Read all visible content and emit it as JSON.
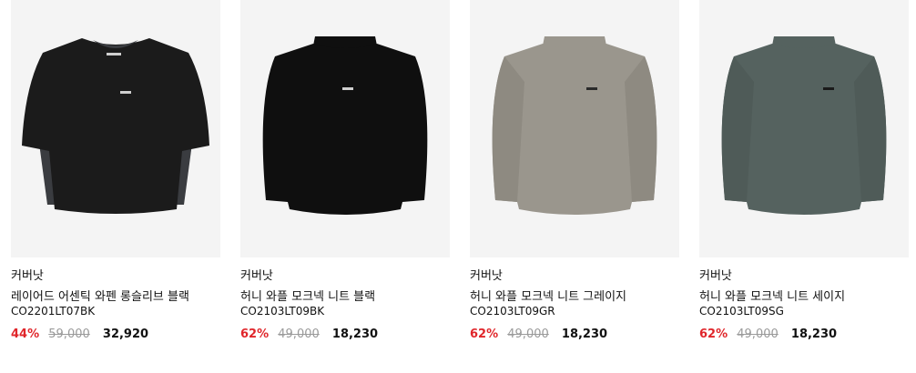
{
  "products": [
    {
      "brand": "커버낫",
      "name": "레이어드 어센틱 와펜 롱슬리브 블랙",
      "code": "CO2201LT07BK",
      "discount": "44%",
      "original_price": "59,000",
      "sale_price": "32,920",
      "body_color": "#1b1b1b",
      "sleeve_color": "#3a3c40"
    },
    {
      "brand": "커버낫",
      "name": "허니 와플 모크넥 니트 블랙",
      "code": "CO2103LT09BK",
      "discount": "62%",
      "original_price": "49,000",
      "sale_price": "18,230",
      "body_color": "#0f0f0f",
      "sleeve_color": "#0f0f0f"
    },
    {
      "brand": "커버낫",
      "name": "허니 와플 모크넥 니트 그레이지",
      "code": "CO2103LT09GR",
      "discount": "62%",
      "original_price": "49,000",
      "sale_price": "18,230",
      "body_color": "#9a968d",
      "sleeve_color": "#8e8a81"
    },
    {
      "brand": "커버낫",
      "name": "허니 와플 모크넥 니트 세이지",
      "code": "CO2103LT09SG",
      "discount": "62%",
      "original_price": "49,000",
      "sale_price": "18,230",
      "body_color": "#55625f",
      "sleeve_color": "#4f5b58"
    }
  ]
}
